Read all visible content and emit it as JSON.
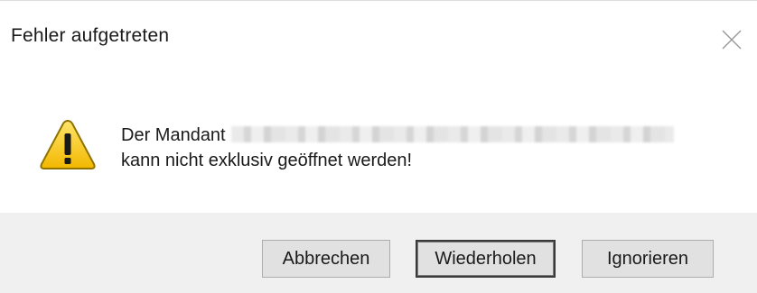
{
  "dialog": {
    "title": "Fehler aufgetreten",
    "close_icon": "close-icon",
    "warning_icon": "warning-triangle-icon",
    "message_prefix": "Der Mandant",
    "message_path": "",
    "message_line2": "kann nicht exklusiv geöffnet werden!",
    "buttons": {
      "cancel_label": "Abbrechen",
      "retry_label": "Wiederholen",
      "ignore_label": "Ignorieren"
    }
  },
  "colors": {
    "footer_bg": "#f0f0f0",
    "button_bg": "#e1e1e1",
    "warning_fill": "#f6c500",
    "warning_stroke": "#9a7b00"
  }
}
